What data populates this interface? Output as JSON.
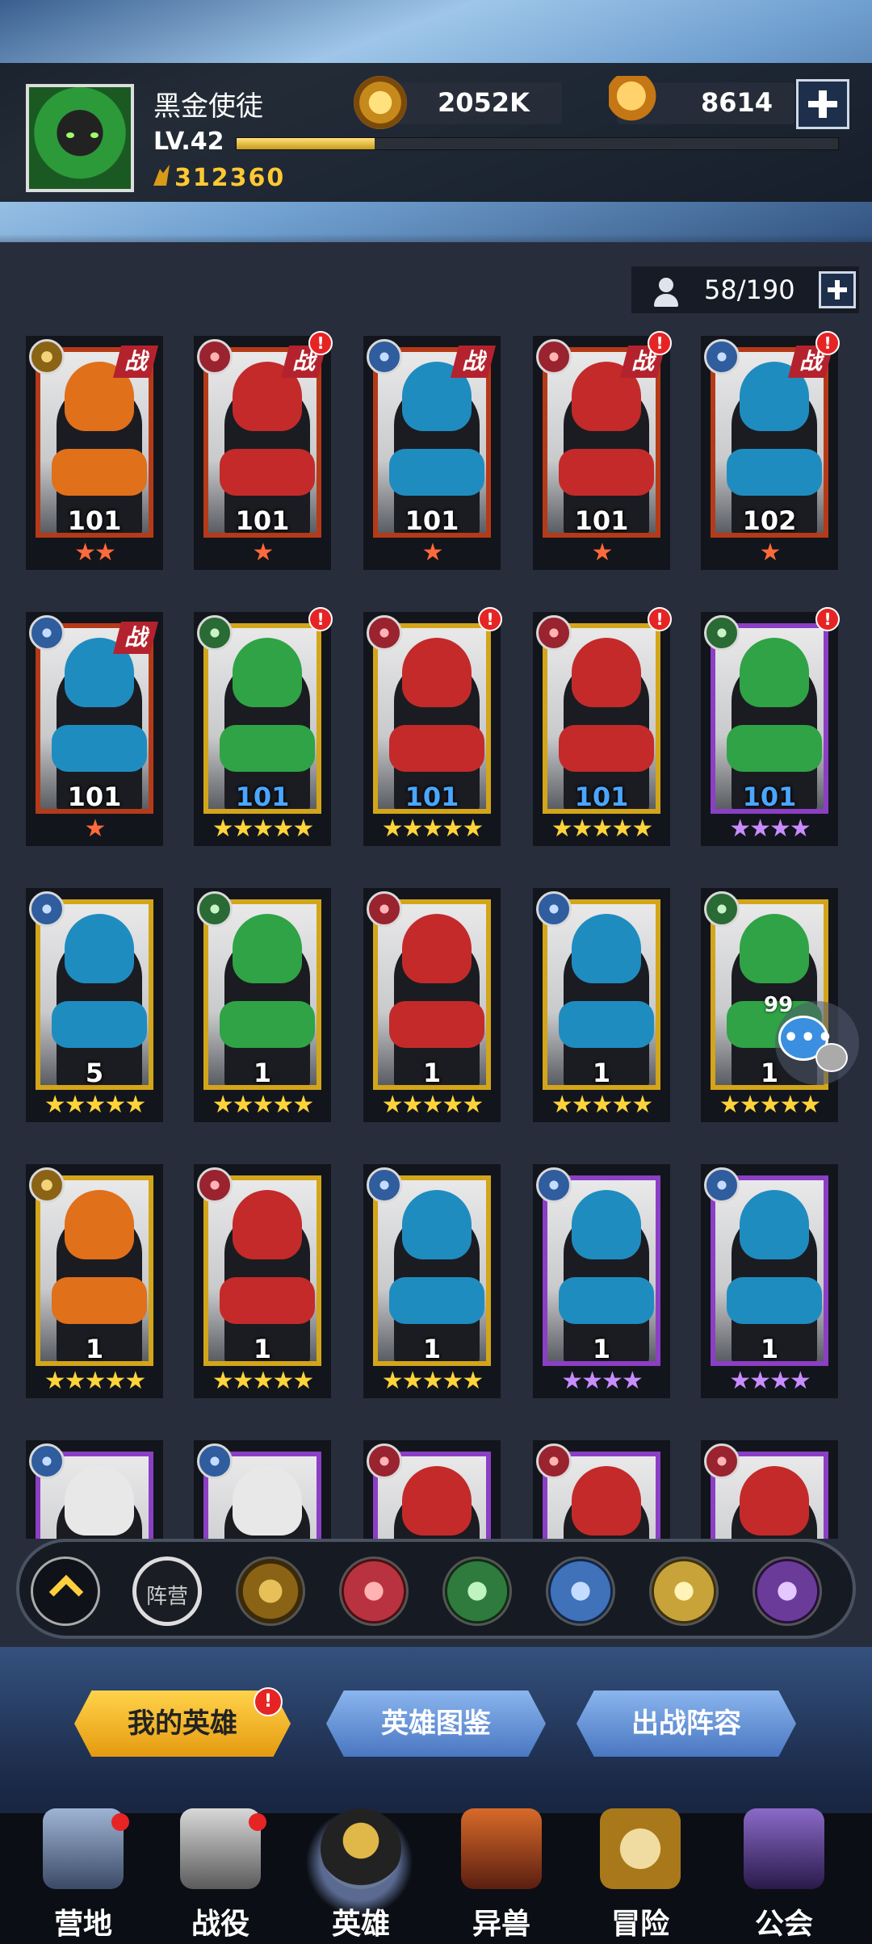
{
  "player": {
    "name": "黑金使徒",
    "level": "LV.42",
    "power": "312360",
    "xp_fraction": 0.23
  },
  "resources": {
    "gold": "2052K",
    "trophy": "8614"
  },
  "hero_capacity": "58/190",
  "heroes": [
    {
      "level": "101",
      "stars": "★★",
      "star_color": "red",
      "frame": "red",
      "faction": "sun-icon",
      "battle": "战",
      "alert": false,
      "lvl_color": "white"
    },
    {
      "level": "101",
      "stars": "★",
      "star_color": "red",
      "frame": "red",
      "faction": "fire-icon",
      "battle": "战",
      "alert": true,
      "lvl_color": "white"
    },
    {
      "level": "101",
      "stars": "★",
      "star_color": "red",
      "frame": "red",
      "faction": "water-icon",
      "battle": "战",
      "alert": false,
      "lvl_color": "white"
    },
    {
      "level": "101",
      "stars": "★",
      "star_color": "red",
      "frame": "red",
      "faction": "fire-icon",
      "battle": "战",
      "alert": true,
      "lvl_color": "white"
    },
    {
      "level": "102",
      "stars": "★",
      "star_color": "red",
      "frame": "red",
      "faction": "water-icon",
      "battle": "战",
      "alert": true,
      "lvl_color": "white"
    },
    {
      "level": "101",
      "stars": "★",
      "star_color": "red",
      "frame": "red",
      "faction": "water-icon",
      "battle": "战",
      "alert": false,
      "lvl_color": "white"
    },
    {
      "level": "101",
      "stars": "★★★★★",
      "star_color": "gold",
      "frame": "gold",
      "faction": "leaf-icon",
      "battle": "",
      "alert": true,
      "lvl_color": "blue"
    },
    {
      "level": "101",
      "stars": "★★★★★",
      "star_color": "gold",
      "frame": "gold",
      "faction": "fire-icon",
      "battle": "",
      "alert": true,
      "lvl_color": "blue"
    },
    {
      "level": "101",
      "stars": "★★★★★",
      "star_color": "gold",
      "frame": "gold",
      "faction": "fire-icon",
      "battle": "",
      "alert": true,
      "lvl_color": "blue"
    },
    {
      "level": "101",
      "stars": "★★★★",
      "star_color": "purple",
      "frame": "purple",
      "faction": "leaf-icon",
      "battle": "",
      "alert": true,
      "lvl_color": "blue"
    },
    {
      "level": "5",
      "stars": "★★★★★",
      "star_color": "gold",
      "frame": "gold",
      "faction": "water-icon",
      "battle": "",
      "alert": false,
      "lvl_color": "white"
    },
    {
      "level": "1",
      "stars": "★★★★★",
      "star_color": "gold",
      "frame": "gold",
      "faction": "leaf-icon",
      "battle": "",
      "alert": false,
      "lvl_color": "white"
    },
    {
      "level": "1",
      "stars": "★★★★★",
      "star_color": "gold",
      "frame": "gold",
      "faction": "fire-icon",
      "battle": "",
      "alert": false,
      "lvl_color": "white"
    },
    {
      "level": "1",
      "stars": "★★★★★",
      "star_color": "gold",
      "frame": "gold",
      "faction": "water-icon",
      "battle": "",
      "alert": false,
      "lvl_color": "white"
    },
    {
      "level": "1",
      "stars": "★★★★★",
      "star_color": "gold",
      "frame": "gold",
      "faction": "leaf-icon",
      "battle": "",
      "alert": false,
      "lvl_color": "white"
    },
    {
      "level": "1",
      "stars": "★★★★★",
      "star_color": "gold",
      "frame": "gold",
      "faction": "sun-icon",
      "battle": "",
      "alert": false,
      "lvl_color": "white"
    },
    {
      "level": "1",
      "stars": "★★★★★",
      "star_color": "gold",
      "frame": "gold",
      "faction": "fire-icon",
      "battle": "",
      "alert": false,
      "lvl_color": "white"
    },
    {
      "level": "1",
      "stars": "★★★★★",
      "star_color": "gold",
      "frame": "gold",
      "faction": "water-icon",
      "battle": "",
      "alert": false,
      "lvl_color": "white"
    },
    {
      "level": "1",
      "stars": "★★★★",
      "star_color": "purple",
      "frame": "purple",
      "faction": "water-icon",
      "battle": "",
      "alert": false,
      "lvl_color": "white"
    },
    {
      "level": "1",
      "stars": "★★★★",
      "star_color": "purple",
      "frame": "purple",
      "faction": "water-icon",
      "battle": "",
      "alert": false,
      "lvl_color": "white"
    }
  ],
  "partial_row": [
    "water-icon",
    "water-icon",
    "fire-icon",
    "fire-icon",
    "fire-icon"
  ],
  "chat": {
    "count": "99"
  },
  "filters": {
    "camp_label": "阵营"
  },
  "tabs": [
    {
      "label": "我的英雄",
      "active": true
    },
    {
      "label": "英雄图鉴",
      "active": false
    },
    {
      "label": "出战阵容",
      "active": false
    }
  ],
  "alert_mark": "!",
  "nav": [
    {
      "label": "营地",
      "icon": "camp-icon",
      "dot": true
    },
    {
      "label": "战役",
      "icon": "battle-icon",
      "dot": true
    },
    {
      "label": "英雄",
      "icon": "hero-icon",
      "dot": false,
      "active": true
    },
    {
      "label": "异兽",
      "icon": "beast-icon",
      "dot": false
    },
    {
      "label": "冒险",
      "icon": "adventure-icon",
      "dot": false
    },
    {
      "label": "公会",
      "icon": "guild-icon",
      "dot": false
    }
  ],
  "colors": {
    "accent": "#ffcf3e",
    "fire": "#b8333f",
    "water": "#3f72b8",
    "leaf": "#2f7a3d",
    "sun": "#b98b2a",
    "light": "#c7a33a",
    "dark": "#6b3b9a"
  }
}
